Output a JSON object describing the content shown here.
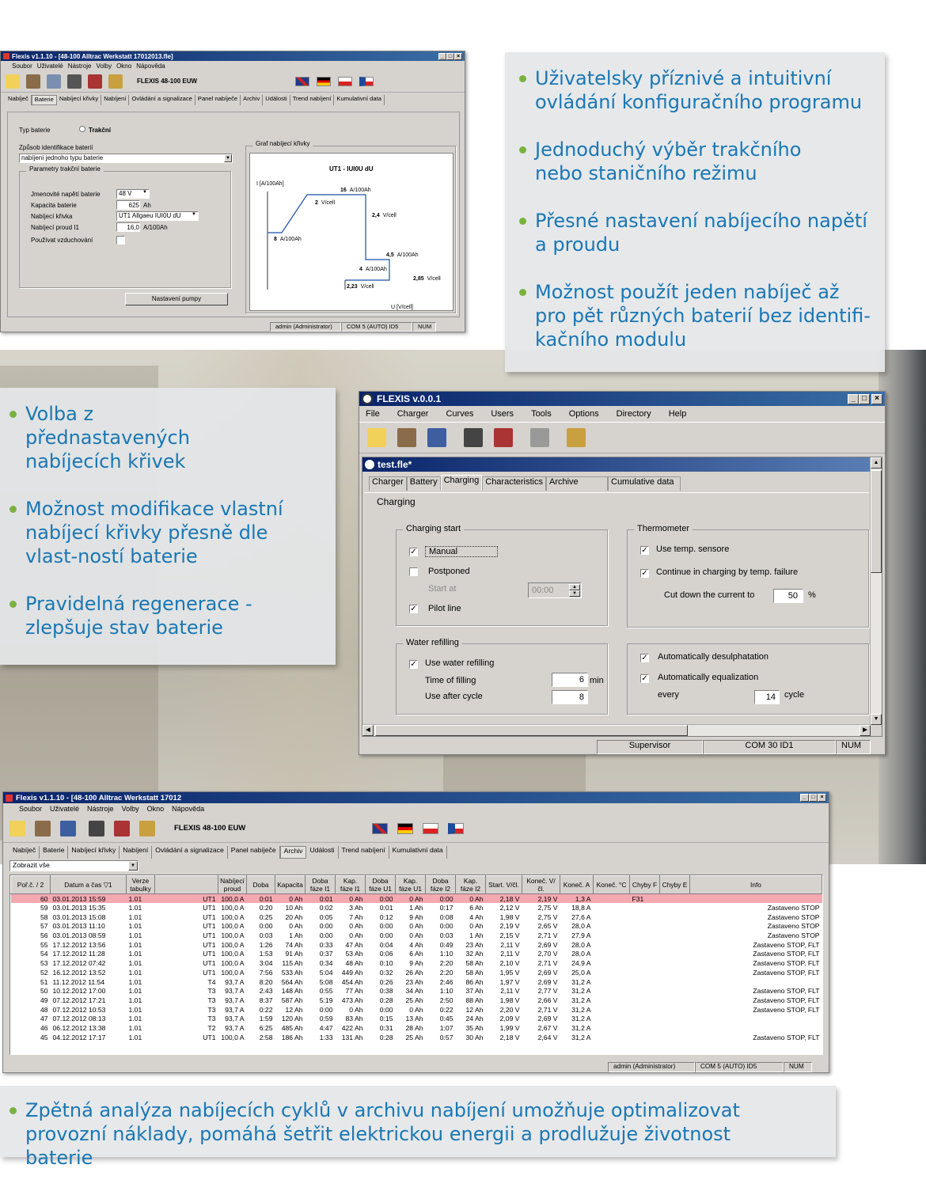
{
  "top_bullets": [
    "Uživatelsky příznivé a intuitivní ovládání konfiguračního programu",
    "Jednoduchý výběr trakčního nebo staničního režimu",
    "Přesné nastavení nabíjecího napětí a proudu",
    "Možnost použít jeden nabíječ až pro pět různých baterií bez identifi-kačního modulu"
  ],
  "mid_bullets": [
    "Volba z přednastavených nabíjecích křivek",
    "Možnost modifikace vlastní nabíjecí křivky přesně dle vlast-ností baterie",
    "Pravidelná regenerace - zlepšuje stav baterie"
  ],
  "bottom_bullet": "Zpětná analýza nabíjecích cyklů v archivu nabíjení umožňuje optimalizovat provozní náklady, pomáhá šetřit elektrickou energii a prodlužuje životnost baterie",
  "win1": {
    "title": "Flexis v1.1.10 - [48-100 Alltrac Werkstatt 17012013.fle]",
    "menu": [
      "Soubor",
      "Uživatelé",
      "Nástroje",
      "Volby",
      "Okno",
      "Nápověda"
    ],
    "device": "FLEXIS 48-100 EUW",
    "tabs": [
      "Nabíječ",
      "Baterie",
      "Nabíjecí křivky",
      "Nabíjení",
      "Ovládání a signalizace",
      "Panel nabíječe",
      "Archiv",
      "Události",
      "Trend nabíjení",
      "Kumulativní data"
    ],
    "battery_type_label": "Typ baterie",
    "battery_type_value": "Trakční",
    "ident_label": "Způsob identifikace baterií",
    "ident_value": "nabíjení jednoho typu baterie",
    "params_label": "Parametry trakční baterie",
    "fields": [
      {
        "label": "Jmenovité napětí baterie",
        "value": "48 V"
      },
      {
        "label": "Kapacita baterie",
        "value": "625",
        "unit": "Ah"
      },
      {
        "label": "Nabíjecí křivka",
        "value": "UT1 Allgaeu   IUI0U dU"
      },
      {
        "label": "Nabíjecí proud I1",
        "value": "16,0",
        "unit": "A/100Ah"
      },
      {
        "label": "Používat vzduchování",
        "value": ""
      }
    ],
    "pump_button": "Nastavení pumpy",
    "graph_group": "Graf nabíjecí křivky",
    "graph": {
      "title": "UT1 - IUI0U dU",
      "y_axis": "I [A/100Ah]",
      "x_axis": "U [V/cell]",
      "labels": [
        {
          "a": "16",
          "b": "A/100Ah"
        },
        {
          "a": "2",
          "b": "V/cell"
        },
        {
          "a": "2,4",
          "b": "V/cell"
        },
        {
          "a": "8",
          "b": "A/100Ah"
        },
        {
          "a": "4,5",
          "b": "A/100Ah"
        },
        {
          "a": "4",
          "b": "A/100Ah"
        },
        {
          "a": "2,85",
          "b": "V/cell"
        },
        {
          "a": "2,23",
          "b": "V/cell"
        }
      ]
    },
    "status": [
      "admin (Administrator)",
      "COM 5  (AUTO)  ID5",
      "NUM"
    ]
  },
  "win2": {
    "title": "FLEXIS  v.0.0.1",
    "menu": [
      "File",
      "Charger",
      "Curves",
      "Users",
      "Tools",
      "Options",
      "Directory",
      "Help"
    ],
    "doc_title": "test.fle*",
    "tabs": [
      "Charger",
      "Battery",
      "Charging",
      "Characteristics",
      "Archive",
      "Cumulative data"
    ],
    "section": "Charging",
    "charging_start": {
      "label": "Charging start",
      "manual": "Manual",
      "postponed": "Postponed",
      "start_at": "Start at",
      "time": "00:00",
      "pilot": "Pilot line"
    },
    "thermometer": {
      "label": "Thermometer",
      "use": "Use temp. sensore",
      "continue": "Continue in charging by temp. failure",
      "cut": "Cut down the current to",
      "cut_value": "50",
      "pct": "%"
    },
    "water": {
      "label": "Water refilling",
      "use": "Use water refilling",
      "time": "Time of filling",
      "time_value": "6",
      "min": "min",
      "after": "Use after cycle",
      "after_value": "8"
    },
    "auto": {
      "desulph": "Automatically desulphatation",
      "equal": "Automatically equalization",
      "every": "every",
      "every_value": "14",
      "cycle": "cycle"
    },
    "status": [
      "Supervisor",
      "COM 30   ID1",
      "NUM"
    ]
  },
  "win3": {
    "title": "Flexis v1.1.10 - [48-100 Alltrac Werkstatt 17012",
    "menu": [
      "Soubor",
      "Uživatelé",
      "Nástroje",
      "Volby",
      "Okno",
      "Nápověda"
    ],
    "device": "FLEXIS 48-100 EUW",
    "tabs": [
      "Nabíječ",
      "Baterie",
      "Nabíjecí křivky",
      "Nabíjení",
      "Ovládání a signalizace",
      "Panel nabíječe",
      "Archiv",
      "Události",
      "Trend nabíjení",
      "Kumulativní data"
    ],
    "filter": "Zobrazit vše",
    "columns": [
      "Poř.č. / 2",
      "Datum a čas   ▽1",
      "Verze tabulky",
      "",
      "Nabíjecí proud",
      "Doba",
      "Kapacita",
      "Doba fáze I1",
      "Kap. fáze I1",
      "Doba fáze U1",
      "Kap. fáze U1",
      "Doba fáze I2",
      "Kap. fáze I2",
      "Start. V/čl.",
      "Koneč. V/čl.",
      "Koneč. A",
      "Koneč. °C",
      "Chyby F",
      "Chyby E",
      "Info"
    ],
    "rows": [
      [
        "60",
        "03.01.2013 15:59",
        "1.01",
        "UT1",
        "100,0 A",
        "0:01",
        "0 Ah",
        "0:01",
        "0 Ah",
        "0:00",
        "0 Ah",
        "0:00",
        "0 Ah",
        "2,18 V",
        "2,19 V",
        "1,3 A",
        "",
        "F31",
        "",
        ""
      ],
      [
        "59",
        "03.01.2013 15:35",
        "1.01",
        "UT1",
        "100,0 A",
        "0:20",
        "10 Ah",
        "0:02",
        "3 Ah",
        "0:01",
        "1 Ah",
        "0:17",
        "6 Ah",
        "2,12 V",
        "2,75 V",
        "18,8 A",
        "",
        "",
        "",
        "Zastaveno STOP"
      ],
      [
        "58",
        "03.01.2013 15:08",
        "1.01",
        "UT1",
        "100,0 A",
        "0:25",
        "20 Ah",
        "0:05",
        "7 Ah",
        "0:12",
        "9 Ah",
        "0:08",
        "4 Ah",
        "1,98 V",
        "2,75 V",
        "27,6 A",
        "",
        "",
        "",
        "Zastaveno STOP"
      ],
      [
        "57",
        "03.01.2013 11:10",
        "1.01",
        "UT1",
        "100,0 A",
        "0:00",
        "0 Ah",
        "0:00",
        "0 Ah",
        "0:00",
        "0 Ah",
        "0:00",
        "0 Ah",
        "2,19 V",
        "2,65 V",
        "28,0 A",
        "",
        "",
        "",
        "Zastaveno STOP"
      ],
      [
        "56",
        "03.01.2013 08:59",
        "1.01",
        "UT1",
        "100,0 A",
        "0:03",
        "1 Ah",
        "0:00",
        "0 Ah",
        "0:00",
        "0 Ah",
        "0:03",
        "1 Ah",
        "2,15 V",
        "2,71 V",
        "27,9 A",
        "",
        "",
        "",
        "Zastaveno STOP"
      ],
      [
        "55",
        "17.12.2012 13:56",
        "1.01",
        "UT1",
        "100,0 A",
        "1:26",
        "74 Ah",
        "0:33",
        "47 Ah",
        "0:04",
        "4 Ah",
        "0:49",
        "23 Ah",
        "2,11 V",
        "2,69 V",
        "28,0 A",
        "",
        "",
        "",
        "Zastaveno STOP, FLT"
      ],
      [
        "54",
        "17.12.2012 11:28",
        "1.01",
        "UT1",
        "100,0 A",
        "1:53",
        "91 Ah",
        "0:37",
        "53 Ah",
        "0:06",
        "6 Ah",
        "1:10",
        "32 Ah",
        "2,11 V",
        "2,70 V",
        "28,0 A",
        "",
        "",
        "",
        "Zastaveno STOP, FLT"
      ],
      [
        "53",
        "17.12.2012 07:42",
        "1.01",
        "UT1",
        "100,0 A",
        "3:04",
        "115 Ah",
        "0:34",
        "48 Ah",
        "0:10",
        "9 Ah",
        "2:20",
        "58 Ah",
        "2,10 V",
        "2,71 V",
        "24,9 A",
        "",
        "",
        "",
        "Zastaveno STOP, FLT"
      ],
      [
        "52",
        "16.12.2012 13:52",
        "1.01",
        "UT1",
        "100,0 A",
        "7:56",
        "533 Ah",
        "5:04",
        "449 Ah",
        "0:32",
        "26 Ah",
        "2:20",
        "58 Ah",
        "1,95 V",
        "2,69 V",
        "25,0 A",
        "",
        "",
        "",
        "Zastaveno STOP, FLT"
      ],
      [
        "51",
        "11.12.2012 11:54",
        "1.01",
        "T4",
        "93,7 A",
        "8:20",
        "564 Ah",
        "5:08",
        "454 Ah",
        "0:26",
        "23 Ah",
        "2:46",
        "86 Ah",
        "1,97 V",
        "2,69 V",
        "31,2 A",
        "",
        "",
        "",
        ""
      ],
      [
        "50",
        "10.12.2012 17:00",
        "1.01",
        "T3",
        "93,7 A",
        "2:43",
        "148 Ah",
        "0:55",
        "77 Ah",
        "0:38",
        "34 Ah",
        "1:10",
        "37 Ah",
        "2,11 V",
        "2,77 V",
        "31,2 A",
        "",
        "",
        "",
        "Zastaveno STOP, FLT"
      ],
      [
        "49",
        "07.12.2012 17:21",
        "1.01",
        "T3",
        "93,7 A",
        "8:37",
        "587 Ah",
        "5:19",
        "473 Ah",
        "0:28",
        "25 Ah",
        "2:50",
        "88 Ah",
        "1,98 V",
        "2,66 V",
        "31,2 A",
        "",
        "",
        "",
        "Zastaveno STOP, FLT"
      ],
      [
        "48",
        "07.12.2012 10:53",
        "1.01",
        "T3",
        "93,7 A",
        "0:22",
        "12 Ah",
        "0:00",
        "0 Ah",
        "0:00",
        "0 Ah",
        "0:22",
        "12 Ah",
        "2,20 V",
        "2,71 V",
        "31,2 A",
        "",
        "",
        "",
        "Zastaveno STOP, FLT"
      ],
      [
        "47",
        "07.12.2012 08:13",
        "1.01",
        "T3",
        "93,7 A",
        "1:59",
        "120 Ah",
        "0:59",
        "83 Ah",
        "0:15",
        "13 Ah",
        "0:45",
        "24 Ah",
        "2,09 V",
        "2,69 V",
        "31,2 A",
        "",
        "",
        "",
        ""
      ],
      [
        "46",
        "06.12.2012 13:38",
        "1.01",
        "T2",
        "93,7 A",
        "6:25",
        "485 Ah",
        "4:47",
        "422 Ah",
        "0:31",
        "28 Ah",
        "1:07",
        "35 Ah",
        "1,99 V",
        "2,67 V",
        "31,2 A",
        "",
        "",
        "",
        ""
      ],
      [
        "45",
        "04.12.2012 17:17",
        "1.01",
        "UT1",
        "100,0 A",
        "2:58",
        "186 Ah",
        "1:33",
        "131 Ah",
        "0:28",
        "25 Ah",
        "0:57",
        "30 Ah",
        "2,18 V",
        "2,64 V",
        "31,2 A",
        "",
        "",
        "",
        "Zastaveno STOP, FLT"
      ]
    ],
    "status": [
      "admin (Administrator)",
      "COM 5  (AUTO)  ID5",
      "NUM"
    ]
  },
  "colors": {
    "bullet_text": "#1a77b4",
    "bullet_dot": "#7ab241",
    "highlight_row": "#f4a8b0",
    "title_bar": "#0a246a"
  }
}
